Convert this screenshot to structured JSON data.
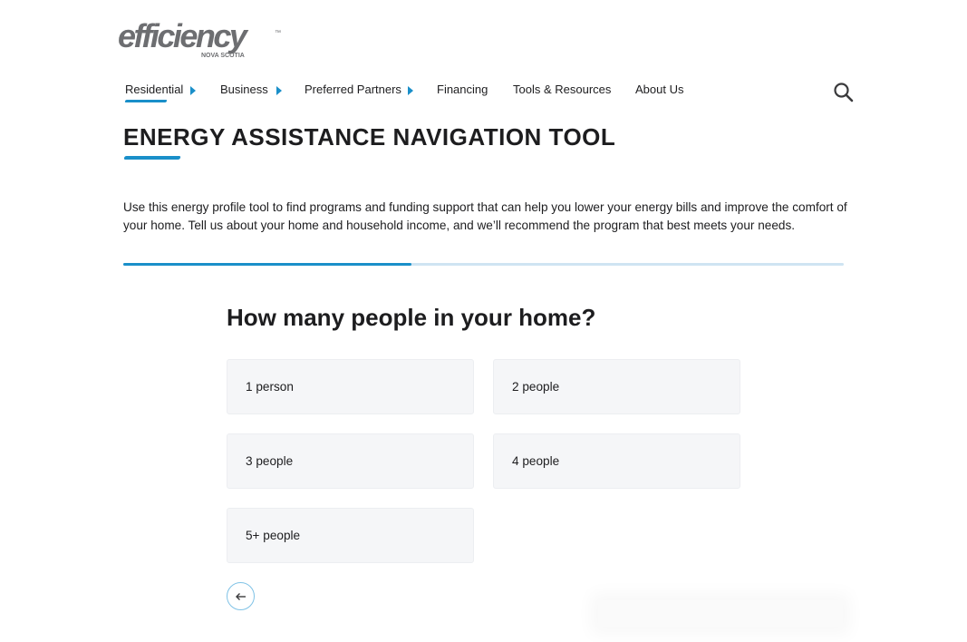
{
  "logo": {
    "wordmark": "efficiency",
    "tagline": "NOVA SCOTIA",
    "trademark": "™"
  },
  "nav": {
    "items": [
      {
        "label": "Residential",
        "has_caret": true,
        "active": true
      },
      {
        "label": "Business",
        "has_caret": true,
        "active": false
      },
      {
        "label": "Preferred Partners",
        "has_caret": true,
        "active": false
      },
      {
        "label": "Financing",
        "has_caret": false,
        "active": false
      },
      {
        "label": "Tools & Resources",
        "has_caret": false,
        "active": false
      },
      {
        "label": "About Us",
        "has_caret": false,
        "active": false
      }
    ],
    "search_icon": "search-icon"
  },
  "page": {
    "title": "ENERGY ASSISTANCE NAVIGATION TOOL",
    "intro": "Use this energy profile tool to find programs and funding support that can help you lower your energy bills and improve the comfort of your home. Tell us about your home and household income, and we’ll recommend the program that best meets your needs.",
    "progress_fraction": 0.4
  },
  "quiz": {
    "question": "How many people in your home?",
    "options": [
      "1 person",
      "2 people",
      "3 people",
      "4 people",
      "5+ people"
    ],
    "back_icon": "arrow-left-icon"
  },
  "colors": {
    "accent": "#1a8fc9",
    "progress_track": "#cfe4f2",
    "option_bg": "#f5f6f8",
    "logo_gray": "#6d6e71",
    "text": "#1d1d1f"
  }
}
